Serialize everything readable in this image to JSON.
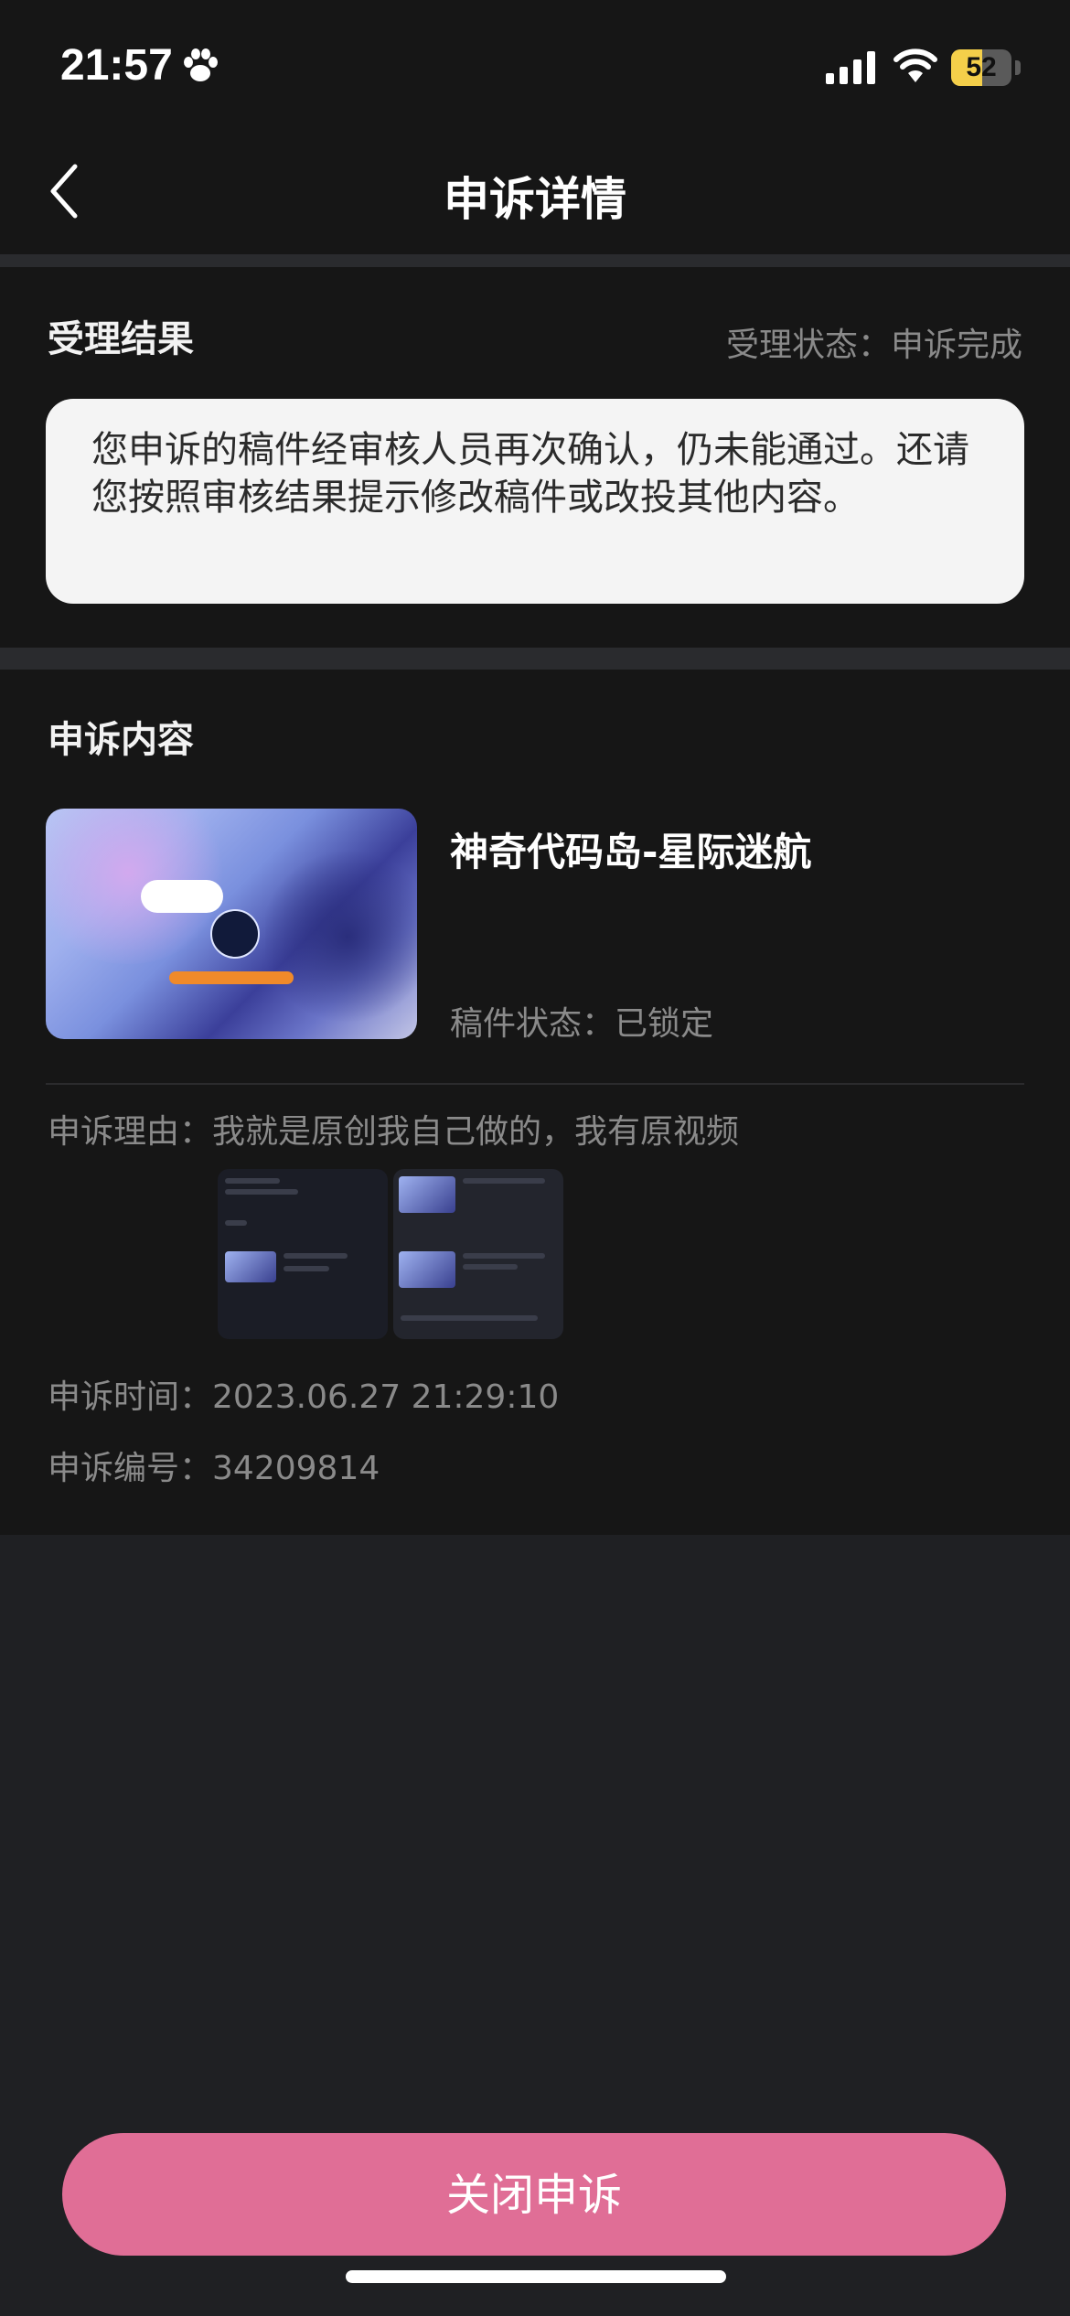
{
  "status_bar": {
    "time": "21:57",
    "battery_level": "52",
    "battery_fraction": 0.52
  },
  "nav": {
    "title": "申诉详情"
  },
  "result_section": {
    "heading": "受理结果",
    "status_label": "受理状态：",
    "status_value": "申诉完成",
    "message": "您申诉的稿件经审核人员再次确认，仍未能通过。还请您按照审核结果提示修改稿件或改投其他内容。"
  },
  "content_section": {
    "heading": "申诉内容",
    "work": {
      "title": "神奇代码岛-星际迷航",
      "status_label": "稿件状态：",
      "status_value": "已锁定"
    },
    "reason_label": "申诉理由：",
    "reason_value": "我就是原创我自己做的，我有原视频",
    "time_label": "申诉时间：",
    "time_value": "2023.06.27 21:29:10",
    "id_label": "申诉编号：",
    "id_value": "34209814"
  },
  "footer": {
    "close_button_label": "关闭申诉"
  },
  "colors": {
    "accent": "#e06e96",
    "background": "#161616",
    "battery": "#f4cf4a"
  }
}
